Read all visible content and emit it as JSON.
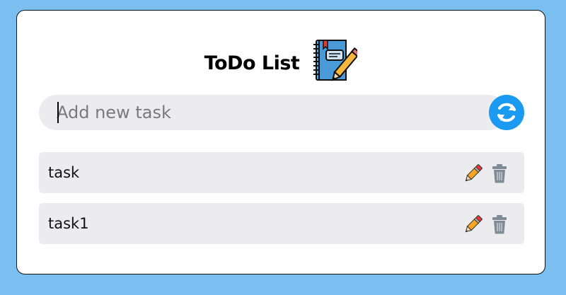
{
  "app": {
    "title": "ToDo List"
  },
  "input": {
    "placeholder": "Add new task",
    "value": ""
  },
  "icons": {
    "title_icon": "notebook-pencil-icon",
    "refresh": "refresh-icon",
    "edit": "pencil-icon",
    "delete": "trash-icon"
  },
  "colors": {
    "background": "#7bbff0",
    "accent": "#1a9af0",
    "row_background": "#ececee"
  },
  "tasks": [
    {
      "text": "task"
    },
    {
      "text": "task1"
    }
  ]
}
